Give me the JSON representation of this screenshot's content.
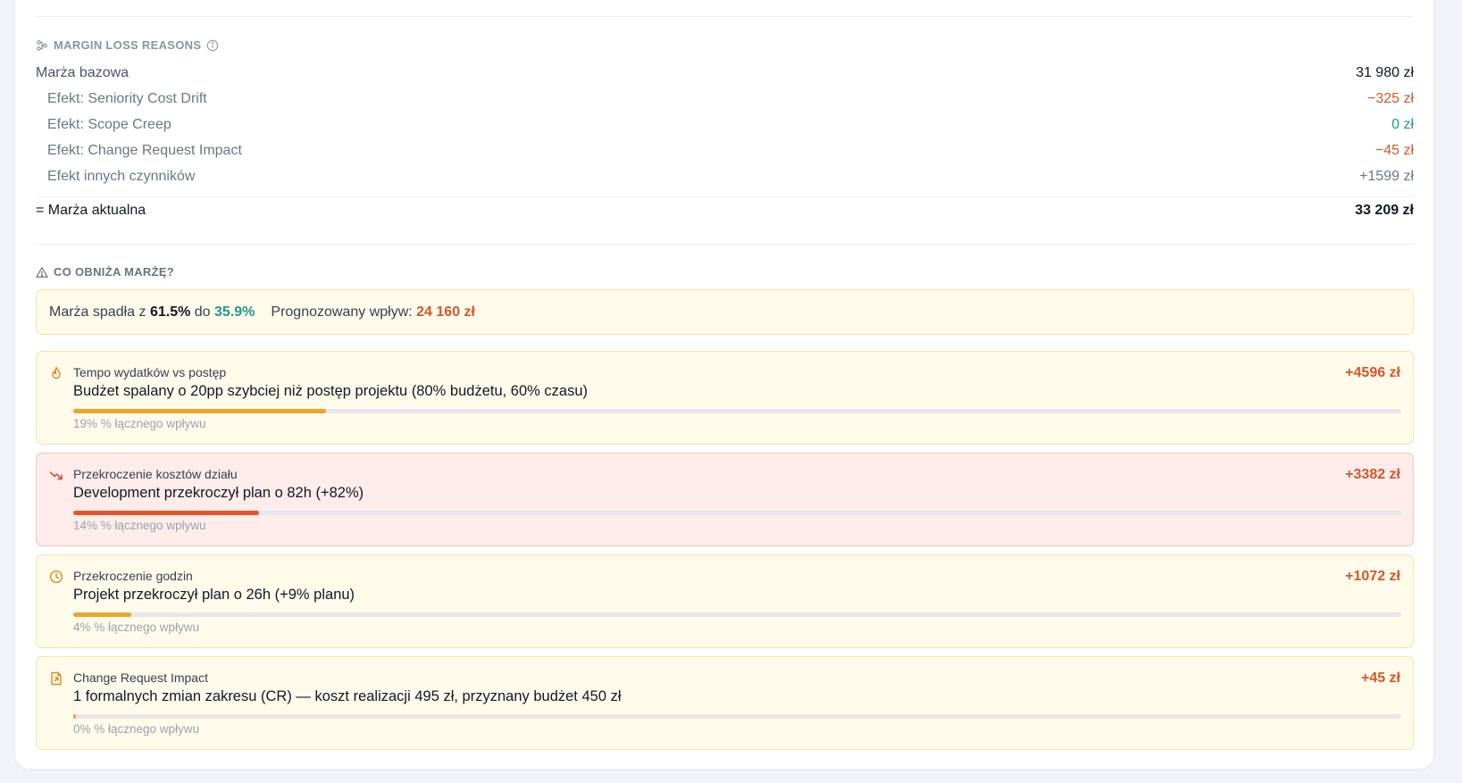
{
  "margin_loss": {
    "header": "MARGIN LOSS REASONS",
    "base": {
      "label": "Marża bazowa",
      "value": "31 980 zł"
    },
    "effects": [
      {
        "label": "Efekt: Seniority Cost Drift",
        "value": "−325 zł",
        "tone": "neg"
      },
      {
        "label": "Efekt: Scope Creep",
        "value": "0 zł",
        "tone": "zero"
      },
      {
        "label": "Efekt: Change Request Impact",
        "value": "−45 zł",
        "tone": "neg"
      },
      {
        "label": "Efekt innych czynników",
        "value": "+1599 zł",
        "tone": "pos"
      }
    ],
    "total": {
      "label": "= Marża aktualna",
      "value": "33 209 zł"
    }
  },
  "what_lowers": {
    "header": "CO OBNIŻA MARŻĘ?",
    "summary": {
      "prefix": "Marża spadła z",
      "from": "61.5%",
      "to_word": "do",
      "to": "35.9%",
      "impact_label": "Prognozowany wpływ:",
      "impact_value": "24 160 zł"
    },
    "reasons": [
      {
        "icon": "flame-icon",
        "title": "Tempo wydatków vs postęp",
        "desc": "Budżet spalany o 20pp szybciej niż postęp projektu (80% budżetu, 60% czasu)",
        "amount": "+4596 zł",
        "share_label": "19% % łącznego wpływu",
        "bar_fraction": 0.19,
        "tone": "yellow"
      },
      {
        "icon": "trending-down-icon",
        "title": "Przekroczenie kosztów działu",
        "desc": "Development przekroczył plan o 82h (+82%)",
        "amount": "+3382 zł",
        "share_label": "14% % łącznego wpływu",
        "bar_fraction": 0.14,
        "tone": "red"
      },
      {
        "icon": "clock-icon",
        "title": "Przekroczenie godzin",
        "desc": "Projekt przekroczył plan o 26h (+9% planu)",
        "amount": "+1072 zł",
        "share_label": "4% % łącznego wpływu",
        "bar_fraction": 0.044,
        "tone": "yellow"
      },
      {
        "icon": "file-diff-icon",
        "title": "Change Request Impact",
        "desc": "1 formalnych zmian zakresu (CR) — koszt realizacji 495 zł, przyznany budżet 450 zł",
        "amount": "+45 zł",
        "share_label": "0% % łącznego wpływu",
        "bar_fraction": 0.002,
        "tone": "yellow"
      }
    ]
  },
  "colors": {
    "accent_orange": "#d4572a",
    "accent_teal": "#1f9a8a",
    "warn_bg": "#fefbea",
    "danger_bg": "#fdecea"
  }
}
